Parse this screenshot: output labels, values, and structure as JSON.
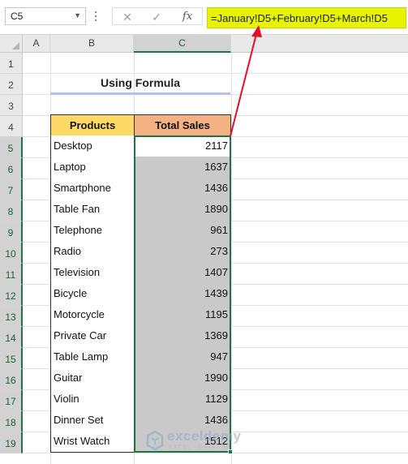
{
  "formula_bar": {
    "name_box": "C5",
    "cancel_icon": "✕",
    "enter_icon": "✓",
    "fx_label": "fx",
    "formula": "=January!D5+February!D5+March!D5"
  },
  "columns": [
    {
      "label": "A",
      "selected": false
    },
    {
      "label": "B",
      "selected": false
    },
    {
      "label": "C",
      "selected": true
    }
  ],
  "rows": [
    "1",
    "2",
    "3",
    "4",
    "5",
    "6",
    "7",
    "8",
    "9",
    "10",
    "11",
    "12",
    "13",
    "14",
    "15",
    "16",
    "17",
    "18",
    "19"
  ],
  "selected_rows_from": 5,
  "sheet": {
    "title": "Using Formula",
    "headers": {
      "products": "Products",
      "sales": "Total Sales"
    },
    "records": [
      {
        "product": "Desktop",
        "sales": "2117"
      },
      {
        "product": "Laptop",
        "sales": "1637"
      },
      {
        "product": "Smartphone",
        "sales": "1436"
      },
      {
        "product": "Table Fan",
        "sales": "1890"
      },
      {
        "product": "Telephone",
        "sales": "961"
      },
      {
        "product": "Radio",
        "sales": "273"
      },
      {
        "product": "Television",
        "sales": "1407"
      },
      {
        "product": "Bicycle",
        "sales": "1439"
      },
      {
        "product": "Motorcycle",
        "sales": "1195"
      },
      {
        "product": "Private Car",
        "sales": "1369"
      },
      {
        "product": "Table Lamp",
        "sales": "947"
      },
      {
        "product": "Guitar",
        "sales": "1990"
      },
      {
        "product": "Violin",
        "sales": "1129"
      },
      {
        "product": "Dinner Set",
        "sales": "1436"
      },
      {
        "product": "Wrist Watch",
        "sales": "1512"
      }
    ]
  },
  "colors": {
    "formula_highlight": "#e7f400",
    "header_products": "#ffd966",
    "header_sales": "#f4b183",
    "selected_fill": "#c9c9c9",
    "selection_border": "#217346",
    "arrow": "#e0112b"
  },
  "watermark": {
    "name": "exceldemy",
    "tagline": "EXCEL · DATA · BI"
  }
}
